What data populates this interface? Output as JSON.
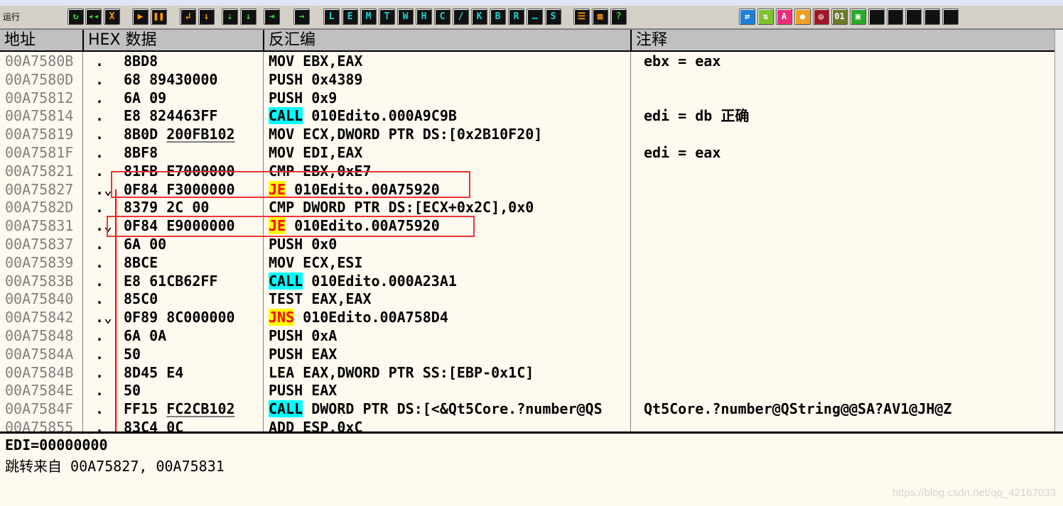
{
  "toolbar": {
    "label": "运行",
    "buttons": [
      {
        "icon": "restart-icon",
        "glyph": "↻",
        "style": "gr"
      },
      {
        "icon": "rewind-icon",
        "glyph": "◂◂",
        "style": "gr"
      },
      {
        "icon": "close-icon",
        "glyph": "X",
        "style": ""
      },
      {
        "icon": "run-icon",
        "glyph": "▶",
        "style": ""
      },
      {
        "icon": "pause-icon",
        "glyph": "❚❚",
        "style": ""
      },
      {
        "icon": "step-into-icon",
        "glyph": "↲",
        "style": ""
      },
      {
        "icon": "step-over-icon",
        "glyph": "↓",
        "style": ""
      },
      {
        "icon": "trace-into-icon",
        "glyph": "⇣",
        "style": "gr"
      },
      {
        "icon": "trace-over-icon",
        "glyph": "↓",
        "style": "gr"
      },
      {
        "icon": "execute-till-return-icon",
        "glyph": "⇥",
        "style": "gr"
      },
      {
        "icon": "go-to-icon",
        "glyph": "→",
        "style": "gr"
      },
      {
        "icon": "log-window-icon",
        "glyph": "L",
        "style": "cy"
      },
      {
        "icon": "modules-window-icon",
        "glyph": "E",
        "style": "cy"
      },
      {
        "icon": "memory-window-icon",
        "glyph": "M",
        "style": "cy"
      },
      {
        "icon": "threads-window-icon",
        "glyph": "T",
        "style": "cy"
      },
      {
        "icon": "windows-window-icon",
        "glyph": "W",
        "style": "cy"
      },
      {
        "icon": "handles-window-icon",
        "glyph": "H",
        "style": "cy"
      },
      {
        "icon": "cpu-window-icon",
        "glyph": "C",
        "style": "cy"
      },
      {
        "icon": "patches-window-icon",
        "glyph": "/",
        "style": "cy"
      },
      {
        "icon": "call-stack-window-icon",
        "glyph": "K",
        "style": "cy"
      },
      {
        "icon": "breakpoints-window-icon",
        "glyph": "B",
        "style": "cy"
      },
      {
        "icon": "references-window-icon",
        "glyph": "R",
        "style": "cy"
      },
      {
        "icon": "run-trace-window-icon",
        "glyph": "…",
        "style": "cy"
      },
      {
        "icon": "source-window-icon",
        "glyph": "S",
        "style": "cy"
      },
      {
        "icon": "list-icon",
        "glyph": "☰",
        "style": ""
      },
      {
        "icon": "grid-icon",
        "glyph": "▦",
        "style": ""
      },
      {
        "icon": "help-icon",
        "glyph": "?",
        "style": "gr"
      }
    ],
    "plugin_buttons": [
      {
        "icon": "swap-icon",
        "glyph": "⇄",
        "color": "#1e7fd8"
      },
      {
        "icon": "updown-icon",
        "glyph": "⇅",
        "color": "#7cc22a"
      },
      {
        "icon": "ascii-icon",
        "glyph": "A",
        "color": "#ee2d7a"
      },
      {
        "icon": "record-icon",
        "glyph": "●",
        "color": "#f0a020"
      },
      {
        "icon": "target-icon",
        "glyph": "◎",
        "color": "#a01828"
      },
      {
        "icon": "binary-icon",
        "glyph": "01",
        "color": "#6a7a2a"
      },
      {
        "icon": "panel-icon",
        "glyph": "▣",
        "color": "#2aa82a"
      }
    ]
  },
  "columns": {
    "address": "地址",
    "hex": "HEX 数据",
    "disasm": "反汇编",
    "comment": "注释"
  },
  "rows": [
    {
      "addr": "00A7580B",
      "mark": ".",
      "hex": "8BD8",
      "hex_op": "",
      "mnem": "MOV",
      "mtype": "",
      "ops": " EBX,EAX",
      "comment": "ebx = eax"
    },
    {
      "addr": "00A7580D",
      "mark": ".",
      "hex": "68 89430000",
      "hex_op": "",
      "mnem": "PUSH",
      "mtype": "",
      "ops": " 0x4389",
      "comment": ""
    },
    {
      "addr": "00A75812",
      "mark": ".",
      "hex": "6A 09",
      "hex_op": "",
      "mnem": "PUSH",
      "mtype": "",
      "ops": " 0x9",
      "comment": ""
    },
    {
      "addr": "00A75814",
      "mark": ".",
      "hex": "E8 824463FF",
      "hex_op": "",
      "mnem": "CALL",
      "mtype": "call",
      "ops": " 010Edito.000A9C9B",
      "comment": "edi = db 正确"
    },
    {
      "addr": "00A75819",
      "mark": ".",
      "hex": "8B0D ",
      "hex_op": "200FB102",
      "mnem": "MOV",
      "mtype": "",
      "ops": " ECX,DWORD PTR DS:[0x2B10F20]",
      "comment": ""
    },
    {
      "addr": "00A7581F",
      "mark": ".",
      "hex": "8BF8",
      "hex_op": "",
      "mnem": "MOV",
      "mtype": "",
      "ops": " EDI,EAX",
      "comment": "edi = eax"
    },
    {
      "addr": "00A75821",
      "mark": ".",
      "hex": "81FB E7000000",
      "hex_op": "",
      "mnem": "CMP",
      "mtype": "",
      "ops": " EBX,0xE7",
      "comment": ""
    },
    {
      "addr": "00A75827",
      "mark": ".⌄",
      "hex": "0F84 F3000000",
      "hex_op": "",
      "mnem": "JE",
      "mtype": "jcc",
      "ops": " 010Edito.00A75920",
      "comment": ""
    },
    {
      "addr": "00A7582D",
      "mark": ".",
      "hex": "8379 2C 00",
      "hex_op": "",
      "mnem": "CMP",
      "mtype": "",
      "ops": " DWORD PTR DS:[ECX+0x2C],0x0",
      "comment": ""
    },
    {
      "addr": "00A75831",
      "mark": ".⌄",
      "hex": "0F84 E9000000",
      "hex_op": "",
      "mnem": "JE",
      "mtype": "jcc",
      "ops": " 010Edito.00A75920",
      "comment": ""
    },
    {
      "addr": "00A75837",
      "mark": ".",
      "hex": "6A 00",
      "hex_op": "",
      "mnem": "PUSH",
      "mtype": "",
      "ops": " 0x0",
      "comment": ""
    },
    {
      "addr": "00A75839",
      "mark": ".",
      "hex": "8BCE",
      "hex_op": "",
      "mnem": "MOV",
      "mtype": "",
      "ops": " ECX,ESI",
      "comment": ""
    },
    {
      "addr": "00A7583B",
      "mark": ".",
      "hex": "E8 61CB62FF",
      "hex_op": "",
      "mnem": "CALL",
      "mtype": "call",
      "ops": " 010Edito.000A23A1",
      "comment": ""
    },
    {
      "addr": "00A75840",
      "mark": ".",
      "hex": "85C0",
      "hex_op": "",
      "mnem": "TEST",
      "mtype": "",
      "ops": " EAX,EAX",
      "comment": ""
    },
    {
      "addr": "00A75842",
      "mark": ".⌄",
      "hex": "0F89 8C000000",
      "hex_op": "",
      "mnem": "JNS",
      "mtype": "jcc",
      "ops": " 010Edito.00A758D4",
      "comment": ""
    },
    {
      "addr": "00A75848",
      "mark": ".",
      "hex": "6A 0A",
      "hex_op": "",
      "mnem": "PUSH",
      "mtype": "",
      "ops": " 0xA",
      "comment": ""
    },
    {
      "addr": "00A7584A",
      "mark": ".",
      "hex": "50",
      "hex_op": "",
      "mnem": "PUSH",
      "mtype": "",
      "ops": " EAX",
      "comment": ""
    },
    {
      "addr": "00A7584B",
      "mark": ".",
      "hex": "8D45 E4",
      "hex_op": "",
      "mnem": "LEA",
      "mtype": "",
      "ops": " EAX,DWORD PTR SS:[EBP-0x1C]",
      "comment": ""
    },
    {
      "addr": "00A7584E",
      "mark": ".",
      "hex": "50",
      "hex_op": "",
      "mnem": "PUSH",
      "mtype": "",
      "ops": " EAX",
      "comment": ""
    },
    {
      "addr": "00A7584F",
      "mark": ".",
      "hex": "FF15 ",
      "hex_op": "FC2CB102",
      "mnem": "CALL",
      "mtype": "call",
      "ops": " DWORD PTR DS:[<&Qt5Core.?number@QS",
      "comment": "Qt5Core.?number@QString@@SA?AV1@JH@Z"
    },
    {
      "addr": "00A75855",
      "mark": ".",
      "hex": "83C4 0C",
      "hex_op": "",
      "mnem": "ADD",
      "mtype": "",
      "ops": " ESP,0xC",
      "comment": ""
    }
  ],
  "info": {
    "line1": "EDI=00000000",
    "line2": "跳转来自 00A75827, 00A75831"
  },
  "watermark": "https://blog.csdn.net/qq_42167033",
  "colors": {
    "call_bg": "#00ffff",
    "jcc_bg": "#ffff00",
    "jcc_text": "#ff0000",
    "annotation": "#ee3333"
  }
}
